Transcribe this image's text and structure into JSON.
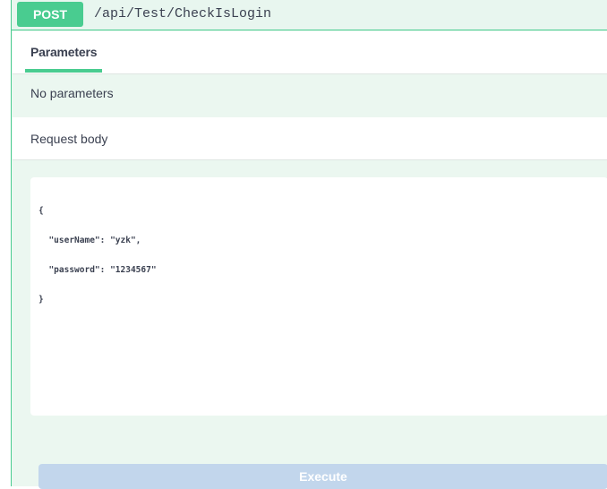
{
  "operation": {
    "method": "POST",
    "path": "/api/Test/CheckIsLogin"
  },
  "tabs": {
    "parameters_label": "Parameters"
  },
  "parameters": {
    "empty_text": "No parameters"
  },
  "request_body": {
    "label": "Request body",
    "lines": [
      "{",
      "  \"userName\": \"yzk\",",
      "  \"password\": \"1234567\"",
      "}"
    ]
  },
  "actions": {
    "execute_label": "Execute"
  },
  "colors": {
    "post_accent": "#49cc90",
    "execute_bg": "#c2d6ec",
    "panel_bg": "#ebf7f0"
  }
}
